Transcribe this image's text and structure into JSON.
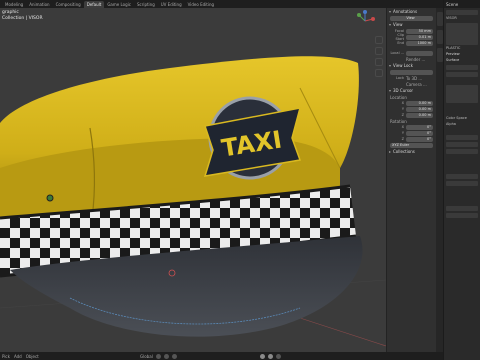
{
  "topbar": {
    "tabs": [
      {
        "label": "Modeling",
        "active": false
      },
      {
        "label": "Animation",
        "active": false
      },
      {
        "label": "Compositing",
        "active": false
      },
      {
        "label": "Default",
        "active": true
      },
      {
        "label": "Game Logic",
        "active": false
      },
      {
        "label": "Scripting",
        "active": false
      },
      {
        "label": "UV Editing",
        "active": false
      },
      {
        "label": "Video Editing",
        "active": false
      }
    ]
  },
  "viewport": {
    "overlay_line1": "graphic",
    "overlay_line2": "Collection | VISOR",
    "hat_badge_text": "TAXI",
    "colors": {
      "bg": "#3b3b3b",
      "crown": "#d9b920",
      "band_dark": "#1a1a1a",
      "band_light": "#ececec",
      "visor": "#3a3d42",
      "badge_plate": "#2a2f3a"
    }
  },
  "npanel": {
    "annotations_label": "Annotations",
    "view_btn": "View",
    "view_section": "View",
    "focal_label": "Focal",
    "focal_value": "50 mm",
    "clip_start_label": "Clip Start",
    "clip_start_value": "0.01 m",
    "clip_end_label": "End",
    "clip_end_value": "1000 m",
    "local_camera_label": "Local ...",
    "render_region_label": "Render ...",
    "view_lock_section": "View Lock",
    "lock_label": "Lock",
    "lock_to_object_label": "To 3D ...",
    "camera_label": "Camera ...",
    "cursor_section": "3D Cursor",
    "location_label": "Location",
    "loc_x": "0.00 m",
    "loc_y": "0.00 m",
    "loc_z": "0.00 m",
    "rotation_label": "Rotation",
    "rot_x": "0°",
    "rot_y": "0°",
    "rot_z": "0°",
    "rotation_mode": "XYZ Euler",
    "collections_section": "Collections"
  },
  "props": {
    "header": "Scene",
    "visor_label": "VISOR",
    "material_label": "PLASTIC",
    "preview_label": "Preview",
    "surface_label": "Surface",
    "color_space_label": "Color Space",
    "alpha_label": "Alpha"
  },
  "bottombar": {
    "items": [
      "Pick",
      "Add",
      "Object"
    ],
    "orientation": "Global"
  }
}
